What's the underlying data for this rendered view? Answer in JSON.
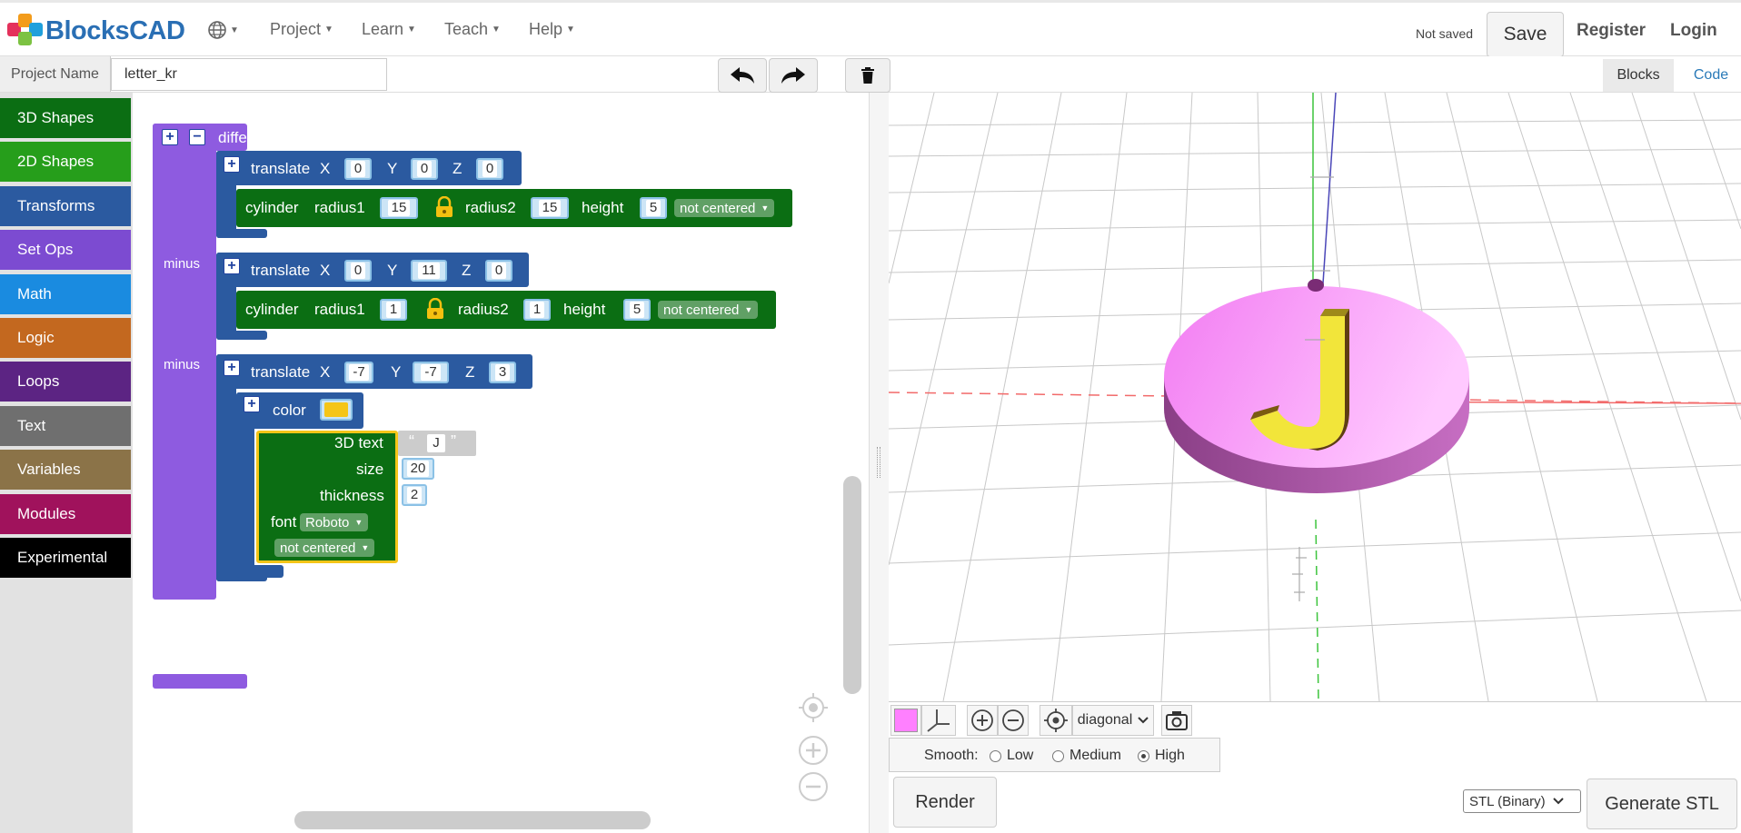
{
  "app": {
    "name": "BlocksCAD"
  },
  "nav": {
    "globe_icon": "globe-icon",
    "items": [
      {
        "label": "Project"
      },
      {
        "label": "Learn"
      },
      {
        "label": "Teach"
      },
      {
        "label": "Help"
      }
    ],
    "status": "Not saved",
    "save": "Save",
    "register": "Register",
    "login": "Login"
  },
  "project": {
    "name_label": "Project Name",
    "name_value": "letter_kr"
  },
  "view_tabs": {
    "blocks": "Blocks",
    "code": "Code"
  },
  "categories": [
    {
      "label": "3D Shapes",
      "color": "#0b6e13"
    },
    {
      "label": "2D Shapes",
      "color": "#269e1b"
    },
    {
      "label": "Transforms",
      "color": "#2b5aa0"
    },
    {
      "label": "Set Ops",
      "color": "#7c4bd1"
    },
    {
      "label": "Math",
      "color": "#1a8be0"
    },
    {
      "label": "Logic",
      "color": "#c3681f"
    },
    {
      "label": "Loops",
      "color": "#5c2483"
    },
    {
      "label": "Text",
      "color": "#6f6f6f"
    },
    {
      "label": "Variables",
      "color": "#8b7348"
    },
    {
      "label": "Modules",
      "color": "#a0125c"
    },
    {
      "label": "Experimental",
      "color": "#000000"
    }
  ],
  "blocks": {
    "difference": "difference",
    "minus": "minus",
    "translate": "translate",
    "x": "X",
    "y": "Y",
    "z": "Z",
    "cylinder": "cylinder",
    "radius1": "radius1",
    "radius2": "radius2",
    "height": "height",
    "not_centered": "not centered",
    "color": "color",
    "text3d": "3D text",
    "size": "size",
    "thickness": "thickness",
    "font": "font",
    "font_value": "Roboto",
    "quote_open": "“",
    "quote_close": "”",
    "t1": {
      "x": "0",
      "y": "0",
      "z": "0"
    },
    "c1": {
      "r1": "15",
      "r2": "15",
      "h": "5"
    },
    "t2": {
      "x": "0",
      "y": "11",
      "z": "0"
    },
    "c2": {
      "r1": "1",
      "r2": "1",
      "h": "5"
    },
    "t3": {
      "x": "-7",
      "y": "-7",
      "z": "3"
    },
    "text_value": "J",
    "size_value": "20",
    "thickness_value": "2",
    "color_value": "#f5c518"
  },
  "viewer": {
    "view_select": "diagonal",
    "object_color": "#ff80ff",
    "smooth_label": "Smooth:",
    "smooth_options": [
      "Low",
      "Medium",
      "High"
    ],
    "smooth_selected": "High",
    "render": "Render",
    "export_format": "STL (Binary)",
    "generate": "Generate STL"
  }
}
